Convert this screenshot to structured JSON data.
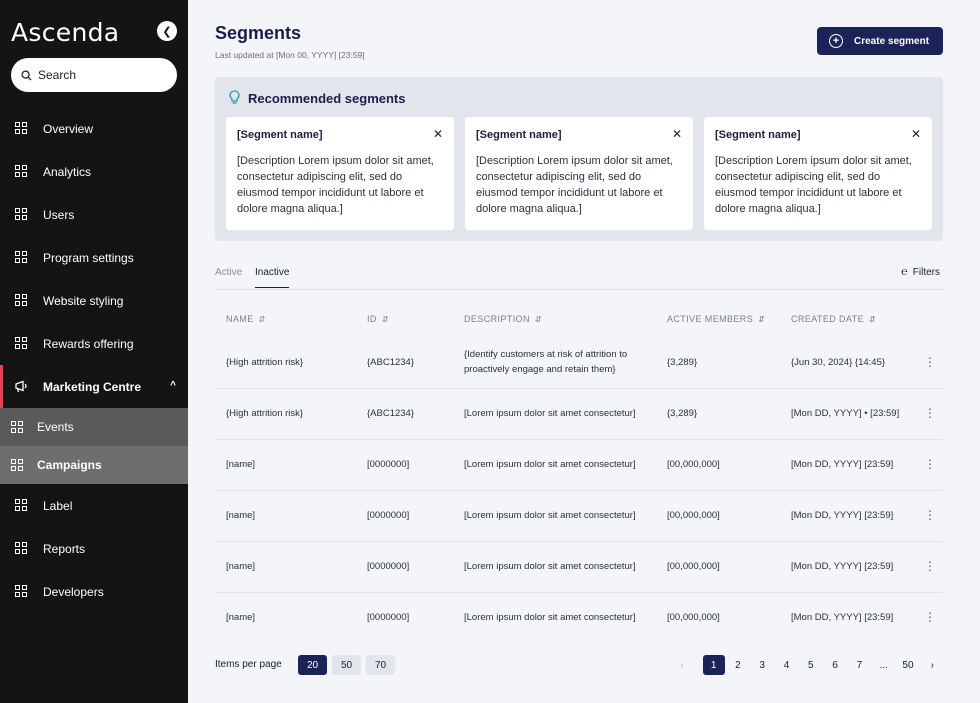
{
  "app": {
    "logo": "Ascenda",
    "collapse_icon": "chevron-left-icon"
  },
  "search": {
    "label": "Search"
  },
  "sidebar": {
    "items": [
      {
        "label": "Overview"
      },
      {
        "label": "Analytics"
      },
      {
        "label": "Users"
      },
      {
        "label": "Program settings"
      },
      {
        "label": "Website styling"
      },
      {
        "label": "Rewards offering"
      },
      {
        "label": "Marketing Centre"
      },
      {
        "label": "Events"
      },
      {
        "label": "Campaigns"
      },
      {
        "label": "Label"
      },
      {
        "label": "Reports"
      },
      {
        "label": "Developers"
      }
    ]
  },
  "header": {
    "title": "Segments",
    "updated": "Last updated at [Mon 00, YYYY] [23:59]",
    "create_label": "Create segment"
  },
  "recommended": {
    "title": "Recommended segments",
    "cards": [
      {
        "title": "[Segment name]",
        "desc": "[Description Lorem ipsum dolor sit amet, consectetur adipiscing elit, sed do eiusmod tempor incididunt ut labore et dolore magna aliqua.]"
      },
      {
        "title": "[Segment name]",
        "desc": "[Description Lorem ipsum dolor sit amet, consectetur adipiscing elit, sed do eiusmod tempor incididunt ut labore et dolore magna aliqua.]"
      },
      {
        "title": "[Segment name]",
        "desc": "[Description Lorem ipsum dolor sit amet, consectetur adipiscing elit, sed do eiusmod tempor incididunt ut labore et dolore magna aliqua.]"
      }
    ]
  },
  "tabs": {
    "active": "Active",
    "inactive": "Inactive",
    "filters": "Filters"
  },
  "table": {
    "headers": [
      "NAME",
      "ID",
      "DESCRIPTION",
      "ACTIVE MEMBERS",
      "CREATED DATE"
    ],
    "rows": [
      [
        "{High attrition risk}",
        "{ABC1234}",
        "{Identify customers at risk of attrition to proactively engage and retain them}",
        "{3,289}",
        "{Jun 30, 2024} {14:45}"
      ],
      [
        "{High attrition risk}",
        "{ABC1234}",
        "[Lorem ipsum dolor sit amet consectetur]",
        "{3,289}",
        "[Mon DD, YYYY] • [23:59]"
      ],
      [
        "[name]",
        "[0000000]",
        "[Lorem ipsum dolor sit amet consectetur]",
        "[00,000,000]",
        "[Mon DD, YYYY] [23:59]"
      ],
      [
        "[name]",
        "[0000000]",
        "[Lorem ipsum dolor sit amet consectetur]",
        "[00,000,000]",
        "[Mon DD, YYYY] [23:59]"
      ],
      [
        "[name]",
        "[0000000]",
        "[Lorem ipsum dolor sit amet consectetur]",
        "[00,000,000]",
        "[Mon DD, YYYY] [23:59]"
      ],
      [
        "[name]",
        "[0000000]",
        "[Lorem ipsum dolor sit amet consectetur]",
        "[00,000,000]",
        "[Mon DD, YYYY] [23:59]"
      ]
    ]
  },
  "pagination": {
    "items_per_page_label": "Items per page",
    "sizes": [
      "20",
      "50",
      "70"
    ],
    "pages": [
      "1",
      "2",
      "3",
      "4",
      "5",
      "6",
      "7",
      "...",
      "50"
    ],
    "current_page": "1",
    "selected_size": "20"
  },
  "colors": {
    "primary": "#1c2358",
    "sidebar_bg": "#141414",
    "accent": "#e5434d"
  }
}
